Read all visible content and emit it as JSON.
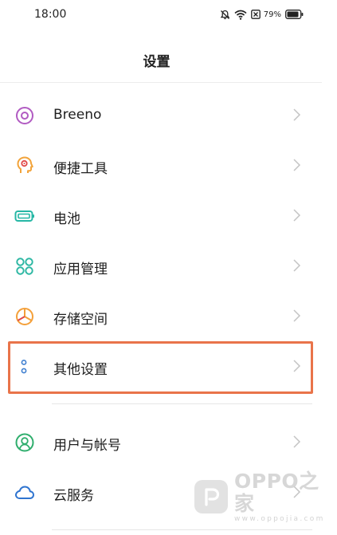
{
  "status_bar": {
    "time": "18:00",
    "battery_percent": "79%",
    "icons": [
      "notifications-muted-icon",
      "wifi-icon",
      "sim-card-icon",
      "battery-icon"
    ]
  },
  "header": {
    "title": "设置"
  },
  "settings": {
    "items": [
      {
        "label": "Breeno",
        "icon": "breeno-icon",
        "icon_color": "#b15bc2"
      },
      {
        "label": "便捷工具",
        "icon": "convenience-tools-icon",
        "icon_color": "#f2a33a"
      },
      {
        "label": "电池",
        "icon": "battery-icon",
        "icon_color": "#25b7a5"
      },
      {
        "label": "应用管理",
        "icon": "app-management-icon",
        "icon_color": "#2fb8a4"
      },
      {
        "label": "存储空间",
        "icon": "storage-icon",
        "icon_color": "#f4a03a"
      },
      {
        "label": "其他设置",
        "icon": "other-settings-icon",
        "icon_color": "#3f7fd0"
      },
      {
        "label": "用户与帐号",
        "icon": "user-account-icon",
        "icon_color": "#2fae6d"
      },
      {
        "label": "云服务",
        "icon": "cloud-service-icon",
        "icon_color": "#2f74d0"
      }
    ]
  },
  "highlight": {
    "target": "其他设置",
    "color": "#e9744a"
  },
  "watermark": {
    "brand": "OPPO之家",
    "url": "www.oppojia.com"
  }
}
